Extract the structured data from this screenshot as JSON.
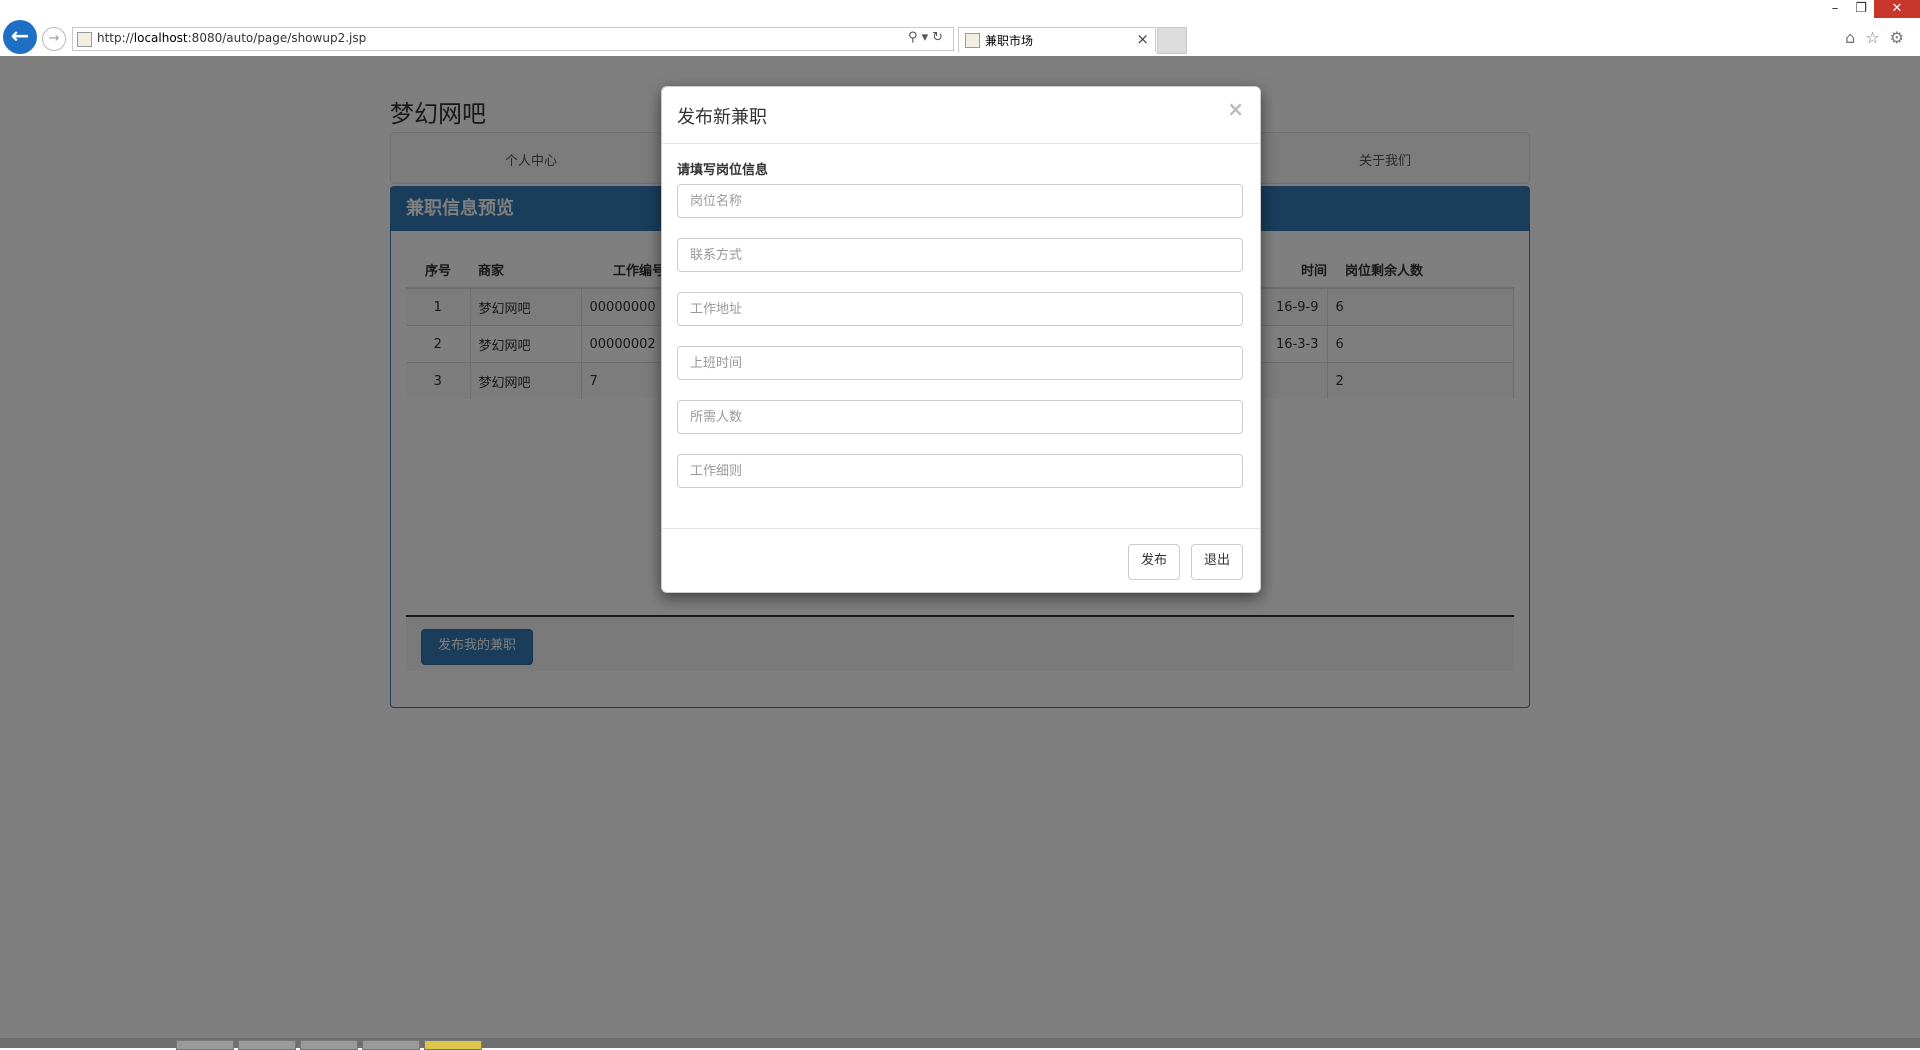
{
  "browser": {
    "url_prefix": "http://",
    "url_host": "localhost",
    "url_rest": ":8080/auto/page/showup2.jsp",
    "tab_title": "兼职市场"
  },
  "site": {
    "title": "梦幻网吧",
    "nav": [
      "个人中心",
      "关于我们"
    ]
  },
  "panel": {
    "heading": "兼职信息预览",
    "columns": [
      "序号",
      "商家",
      "工作编号",
      "岗位剩余人数"
    ],
    "hidden_column_fragment": "时间",
    "rows": [
      {
        "no": "1",
        "merchant": "梦幻网吧",
        "code": "00000000",
        "date_fragment": "16-9-9",
        "remaining": "6"
      },
      {
        "no": "2",
        "merchant": "梦幻网吧",
        "code": "00000002",
        "date_fragment": "16-3-3",
        "remaining": "6"
      },
      {
        "no": "3",
        "merchant": "梦幻网吧",
        "code": "7",
        "date_fragment": "",
        "remaining": "2"
      }
    ],
    "publish_button": "发布我的兼职"
  },
  "modal": {
    "title": "发布新兼职",
    "close": "×",
    "form_label": "请填写岗位信息",
    "fields": [
      {
        "placeholder": "岗位名称",
        "value": ""
      },
      {
        "placeholder": "联系方式",
        "value": ""
      },
      {
        "placeholder": "工作地址",
        "value": ""
      },
      {
        "placeholder": "上班时间",
        "value": ""
      },
      {
        "placeholder": "所需人数",
        "value": ""
      },
      {
        "placeholder": "工作细则",
        "value": ""
      }
    ],
    "submit_label": "发布",
    "cancel_label": "退出"
  }
}
